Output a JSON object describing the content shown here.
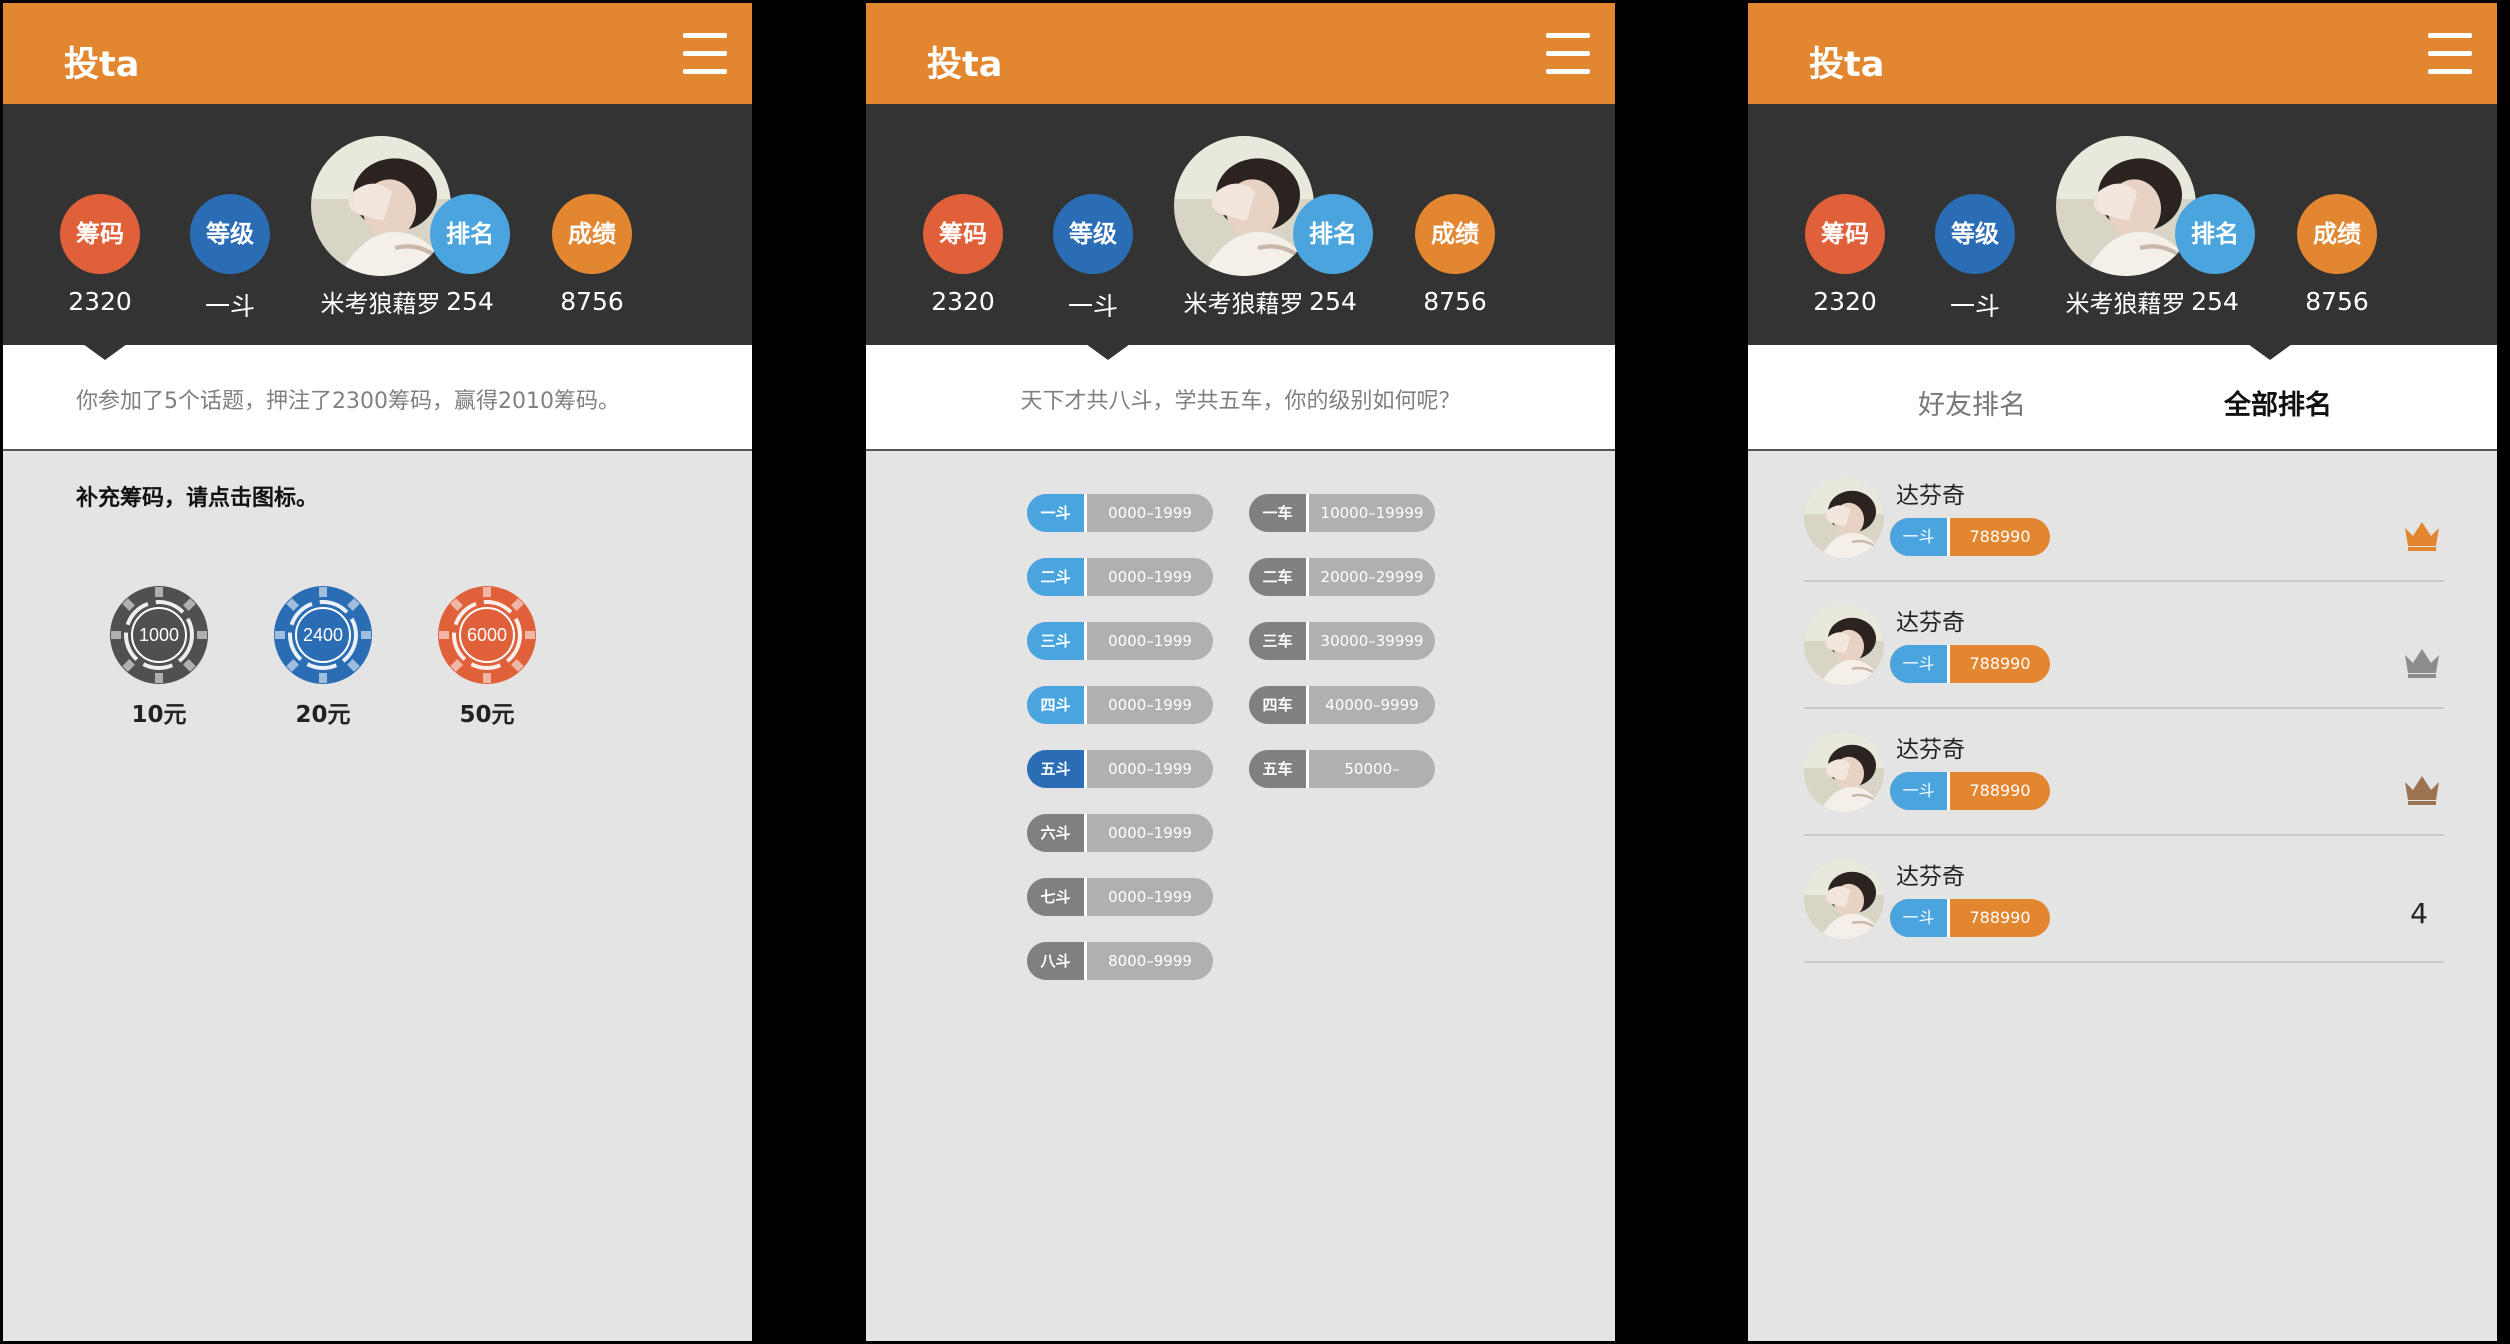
{
  "app": {
    "title": "投ta"
  },
  "profile": {
    "chips_label": "筹码",
    "chips_value": "2320",
    "level_label": "等级",
    "level_value": "一斗",
    "name": "米考狼藉罗",
    "rank_label": "排名",
    "rank_value": "254",
    "score_label": "成绩",
    "score_value": "8756"
  },
  "screen1": {
    "summary": "你参加了5个话题，押注了2300筹码，赢得2010筹码。",
    "recharge_prompt": "补充筹码，请点击图标。",
    "chips": [
      {
        "amount": "1000",
        "price": "10元",
        "color": "#505050"
      },
      {
        "amount": "2400",
        "price": "20元",
        "color": "#2b6db4"
      },
      {
        "amount": "6000",
        "price": "50元",
        "color": "#e0603a"
      }
    ]
  },
  "screen2": {
    "slogan": "天下才共八斗，学共五车，你的级别如何呢？",
    "dou_levels": [
      {
        "label": "一斗",
        "range": "0000–1999",
        "color": "#4aa5de"
      },
      {
        "label": "二斗",
        "range": "0000–1999",
        "color": "#4aa5de"
      },
      {
        "label": "三斗",
        "range": "0000–1999",
        "color": "#4aa5de"
      },
      {
        "label": "四斗",
        "range": "0000–1999",
        "color": "#4aa5de"
      },
      {
        "label": "五斗",
        "range": "0000–1999",
        "color": "#2b6db4"
      },
      {
        "label": "六斗",
        "range": "0000–1999",
        "color": "#808080"
      },
      {
        "label": "七斗",
        "range": "0000–1999",
        "color": "#808080"
      },
      {
        "label": "八斗",
        "range": "8000–9999",
        "color": "#808080"
      }
    ],
    "che_levels": [
      {
        "label": "一车",
        "range": "10000–19999",
        "color": "#808080"
      },
      {
        "label": "二车",
        "range": "20000–29999",
        "color": "#808080"
      },
      {
        "label": "三车",
        "range": "30000–39999",
        "color": "#808080"
      },
      {
        "label": "四车",
        "range": "40000–9999",
        "color": "#808080"
      },
      {
        "label": "五车",
        "range": "50000–",
        "color": "#808080"
      }
    ]
  },
  "screen3": {
    "tab_friends": "好友排名",
    "tab_all": "全部排名",
    "rankings": [
      {
        "name": "达芬奇",
        "level": "一斗",
        "chips": "788990",
        "rank_icon": "crown-gold-icon",
        "crown_color": "#e38630"
      },
      {
        "name": "达芬奇",
        "level": "一斗",
        "chips": "788990",
        "rank_icon": "crown-silver-icon",
        "crown_color": "#8c8c8c"
      },
      {
        "name": "达芬奇",
        "level": "一斗",
        "chips": "788990",
        "rank_icon": "crown-bronze-icon",
        "crown_color": "#9b7350"
      },
      {
        "name": "达芬奇",
        "level": "一斗",
        "chips": "788990",
        "rank": "4"
      }
    ]
  }
}
